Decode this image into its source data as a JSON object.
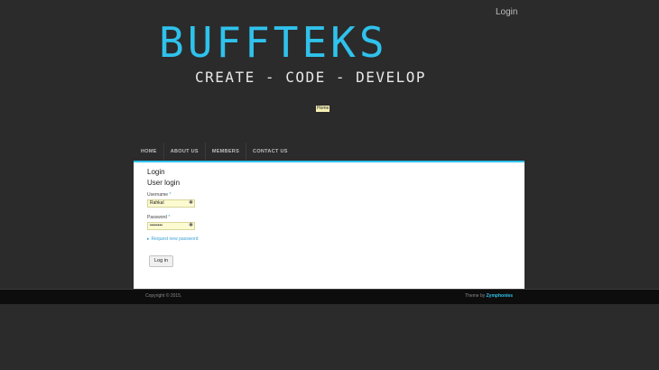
{
  "header": {
    "login_link": "Login",
    "site_name": "BUFFTEKS",
    "slogan": "CREATE - CODE - DEVELOP",
    "breadcrumb": "Home"
  },
  "nav": {
    "items": [
      {
        "label": "HOME"
      },
      {
        "label": "ABOUT US"
      },
      {
        "label": "MEMBERS"
      },
      {
        "label": "CONTACT US"
      }
    ]
  },
  "main": {
    "page_title": "Login",
    "block_title": "User login",
    "username": {
      "label": "Username",
      "required_mark": "*",
      "value": "Rahkal"
    },
    "password": {
      "label": "Password",
      "required_mark": "*",
      "value": "••••••••"
    },
    "request_password": "Request new password",
    "submit_label": "Log in"
  },
  "footer": {
    "copyright": "Copyright © 2015.",
    "theme_prefix": "Theme by",
    "theme_link": "Zymphonies"
  },
  "colors": {
    "accent": "#2fc2ec",
    "background": "#2b2b2b",
    "field_bg": "#fbfad0"
  }
}
